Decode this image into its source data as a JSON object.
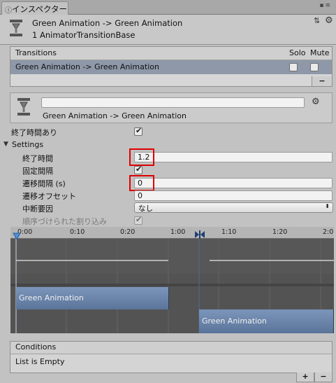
{
  "tab": {
    "label": "インスペクター"
  },
  "header": {
    "title": "Green Animation -> Green Animation",
    "subtitle": "1 AnimatorTransitionBase"
  },
  "transitions": {
    "title": "Transitions",
    "col_solo": "Solo",
    "col_mute": "Mute",
    "rows": [
      {
        "label": "Green Animation -> Green Animation",
        "solo": false,
        "mute": false
      }
    ],
    "remove_label": "−"
  },
  "transition_panel": {
    "name_value": "",
    "caption": "Green Animation -> Green Animation"
  },
  "has_exit_time": {
    "label": "終了時間あり",
    "checked": true
  },
  "settings": {
    "label": "Settings",
    "exit_time": {
      "label": "終了時間",
      "value": "1.2"
    },
    "fixed_duration": {
      "label": "固定間隔",
      "checked": true
    },
    "transition_duration": {
      "label": "遷移間隔 (s)",
      "value": "0"
    },
    "transition_offset": {
      "label": "遷移オフセット",
      "value": "0"
    },
    "interruption_source": {
      "label": "中断要因",
      "value": "なし"
    },
    "ordered_interruption": {
      "label": "順序づけられた割り込み",
      "checked": true
    }
  },
  "timeline": {
    "ticks": [
      "0:00",
      "0:10",
      "0:20",
      "1:00",
      "1:10",
      "1:20",
      "2:0"
    ],
    "clip_a": "Green Animation",
    "clip_b": "Green Animation"
  },
  "conditions": {
    "title": "Conditions",
    "empty_text": "List is Empty",
    "add_label": "+",
    "remove_label": "−"
  },
  "colors": {
    "clip": "#6e88ad",
    "highlight": "#e00000"
  }
}
